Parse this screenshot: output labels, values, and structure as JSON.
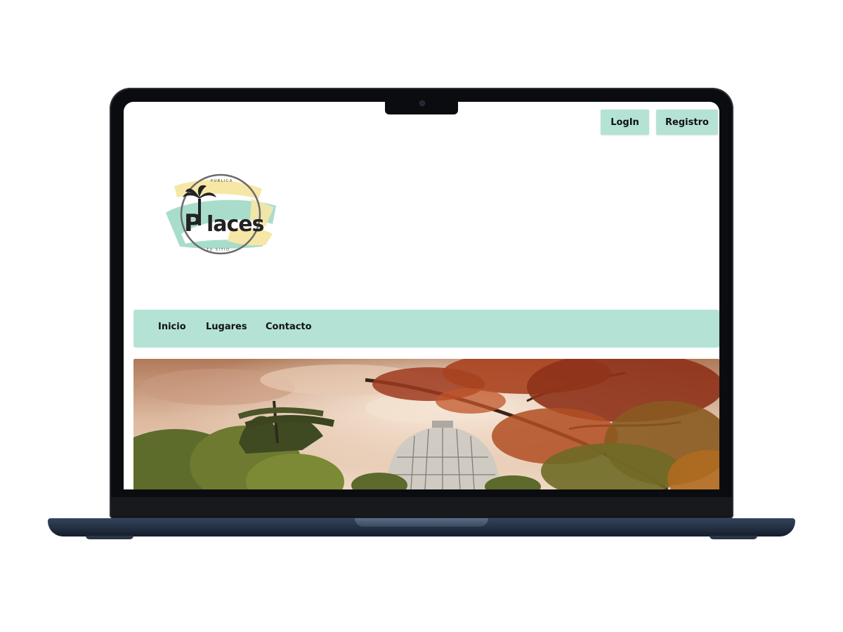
{
  "header": {
    "login_label": "LogIn",
    "register_label": "Registro"
  },
  "logo": {
    "wordmark": "Places",
    "ring_top": "PUBLICA",
    "ring_bottom": "TU SITIO"
  },
  "nav": {
    "items": [
      {
        "label": "Inicio"
      },
      {
        "label": "Lugares"
      },
      {
        "label": "Contacto"
      }
    ]
  },
  "hero": {
    "image": "autumn-garden-glasshouse-photo"
  },
  "colors": {
    "accent": "#b4e3d6",
    "logo_yellow": "#f7e7a6",
    "logo_mint": "#9fd9c6",
    "text": "#111111",
    "device_frame": "#0b0c10",
    "device_base": "#263346"
  }
}
